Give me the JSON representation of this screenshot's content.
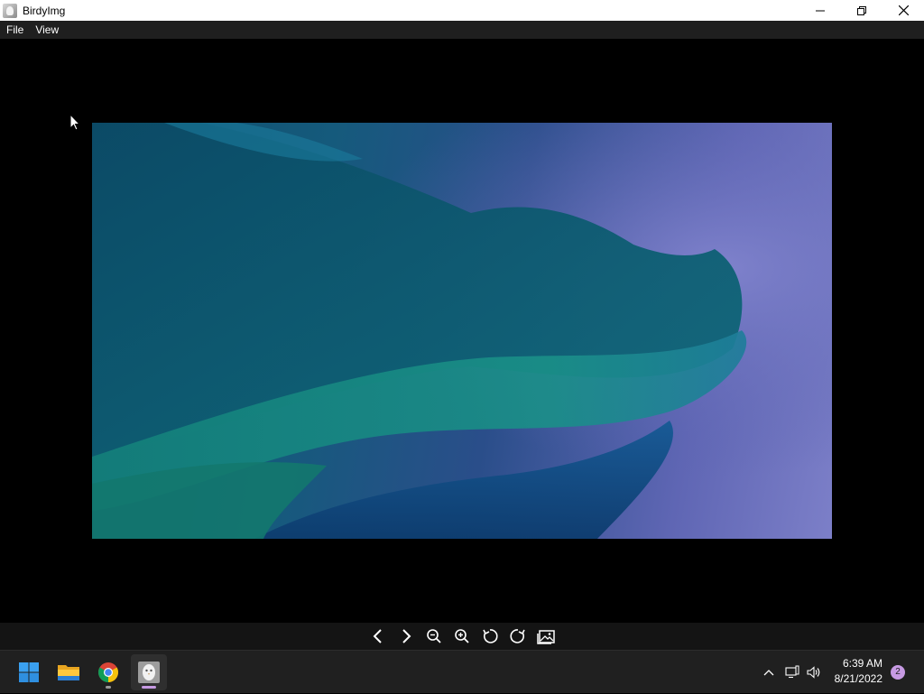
{
  "window": {
    "title": "BirdyImg",
    "minimize_icon": "minimize-icon",
    "restore_icon": "restore-icon",
    "close_icon": "close-icon"
  },
  "menu": {
    "items": [
      {
        "label": "File"
      },
      {
        "label": "View"
      }
    ]
  },
  "toolbar": {
    "tools": [
      {
        "icon": "previous-icon"
      },
      {
        "icon": "next-icon"
      },
      {
        "icon": "zoom-out-icon"
      },
      {
        "icon": "zoom-in-icon"
      },
      {
        "icon": "rotate-left-icon"
      },
      {
        "icon": "rotate-right-icon"
      },
      {
        "icon": "gallery-icon"
      }
    ]
  },
  "taskbar": {
    "apps": [
      {
        "icon": "windows-start-icon"
      },
      {
        "icon": "file-explorer-icon"
      },
      {
        "icon": "chrome-icon"
      },
      {
        "icon": "birdyimg-icon"
      }
    ],
    "clock": {
      "time": "6:39 AM",
      "date": "8/21/2022"
    },
    "notification_count": "2"
  },
  "colors": {
    "taskbar_bg": "#202020",
    "menubar_bg": "#1f1f1f",
    "accent_indicator": "#c79ae3"
  }
}
